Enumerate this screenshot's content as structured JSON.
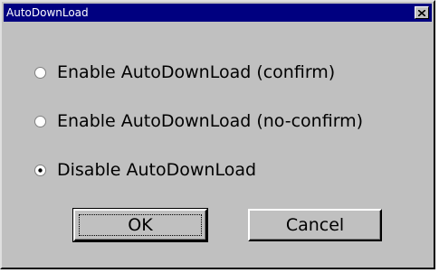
{
  "window": {
    "title": "AutoDownLoad",
    "close_icon": "close-icon"
  },
  "options": [
    {
      "label": "Enable AutoDownLoad (confirm)",
      "selected": false
    },
    {
      "label": "Enable AutoDownLoad (no-confirm)",
      "selected": false
    },
    {
      "label": "Disable AutoDownLoad",
      "selected": true
    }
  ],
  "buttons": {
    "ok_label": "OK",
    "cancel_label": "Cancel"
  },
  "colors": {
    "titlebar": "#000080",
    "face": "#c0c0c0"
  }
}
